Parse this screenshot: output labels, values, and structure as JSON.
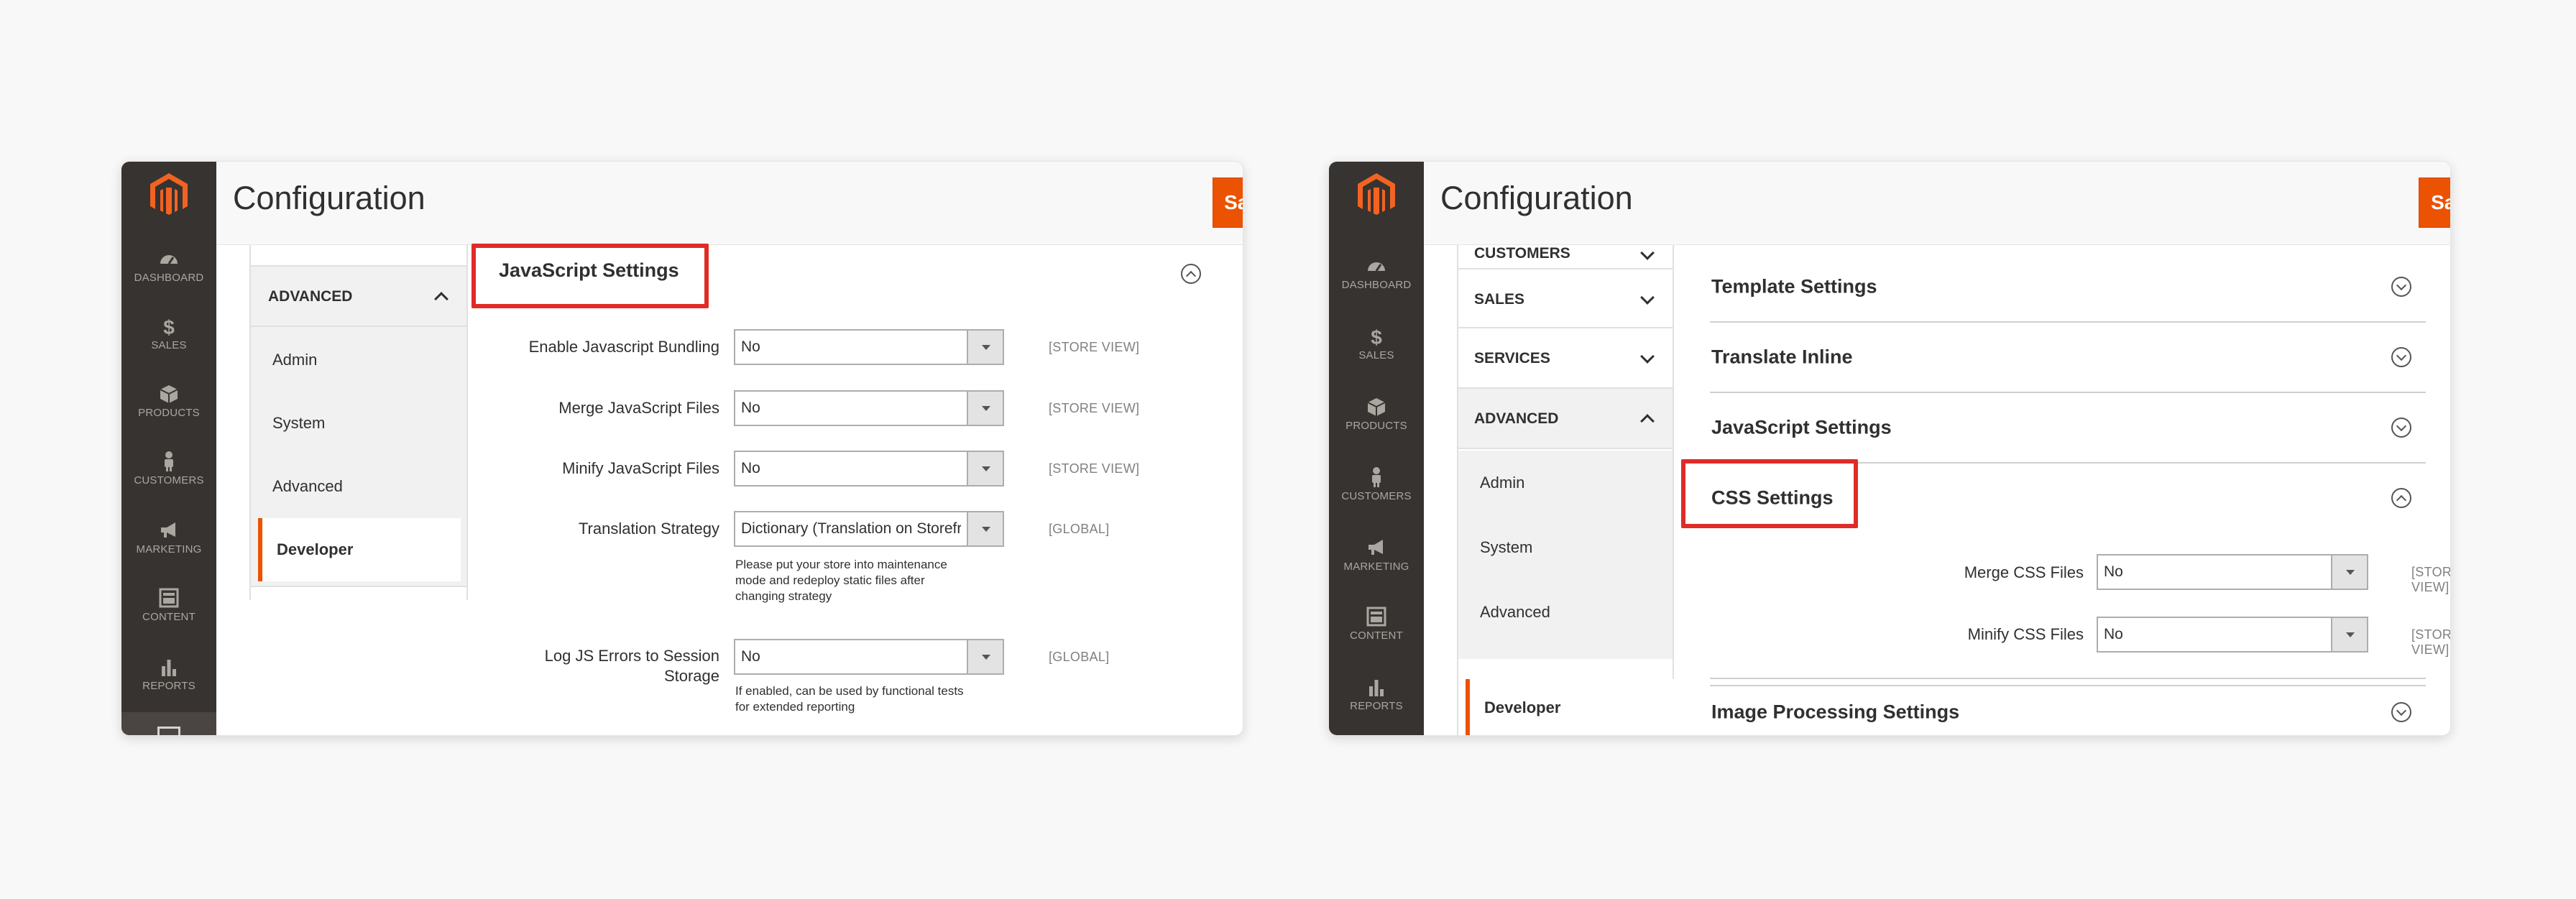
{
  "sidebar": {
    "items": [
      {
        "label": "DASHBOARD",
        "icon": "speedometer-icon"
      },
      {
        "label": "SALES",
        "icon": "dollar-icon"
      },
      {
        "label": "PRODUCTS",
        "icon": "box-icon"
      },
      {
        "label": "CUSTOMERS",
        "icon": "person-icon"
      },
      {
        "label": "MARKETING",
        "icon": "megaphone-icon"
      },
      {
        "label": "CONTENT",
        "icon": "layout-icon"
      },
      {
        "label": "REPORTS",
        "icon": "bar-chart-icon"
      }
    ]
  },
  "colors": {
    "accent": "#eb5202",
    "rail": "#373330",
    "highlight": "#e02b27"
  },
  "left": {
    "title": "Configuration",
    "save_label": "Save Config",
    "nav": {
      "section_label": "ADVANCED",
      "items": [
        "Admin",
        "System",
        "Advanced",
        "Developer"
      ],
      "active": "Developer"
    },
    "section_title": "JavaScript Settings",
    "fields": [
      {
        "label": "Enable Javascript Bundling",
        "value": "No",
        "scope": "[STORE VIEW]"
      },
      {
        "label": "Merge JavaScript Files",
        "value": "No",
        "scope": "[STORE VIEW]"
      },
      {
        "label": "Minify JavaScript Files",
        "value": "No",
        "scope": "[STORE VIEW]"
      },
      {
        "label": "Translation Strategy",
        "value": "Dictionary (Translation on Storefront side)",
        "scope": "[GLOBAL]",
        "note": [
          "Please put your store into maintenance",
          "mode and redeploy static files after",
          "changing strategy"
        ]
      },
      {
        "label_lines": [
          "Log JS Errors to Session",
          "Storage"
        ],
        "value": "No",
        "scope": "[GLOBAL]",
        "note": [
          "If enabled, can be used by functional tests",
          "for extended reporting"
        ]
      }
    ]
  },
  "right": {
    "title": "Configuration",
    "save_label": "Save Config",
    "nav": {
      "tabs": [
        "CUSTOMERS",
        "SALES",
        "SERVICES",
        "ADVANCED"
      ],
      "items": [
        "Admin",
        "System",
        "Advanced",
        "Developer"
      ],
      "active": "Developer"
    },
    "sections": [
      "Template Settings",
      "Translate Inline",
      "JavaScript Settings",
      "CSS Settings",
      "Image Processing Settings"
    ],
    "fields": [
      {
        "label": "Merge CSS Files",
        "value": "No",
        "scope": "[STORE VIEW]"
      },
      {
        "label": "Minify CSS Files",
        "value": "No",
        "scope": "[STORE VIEW]"
      }
    ]
  }
}
